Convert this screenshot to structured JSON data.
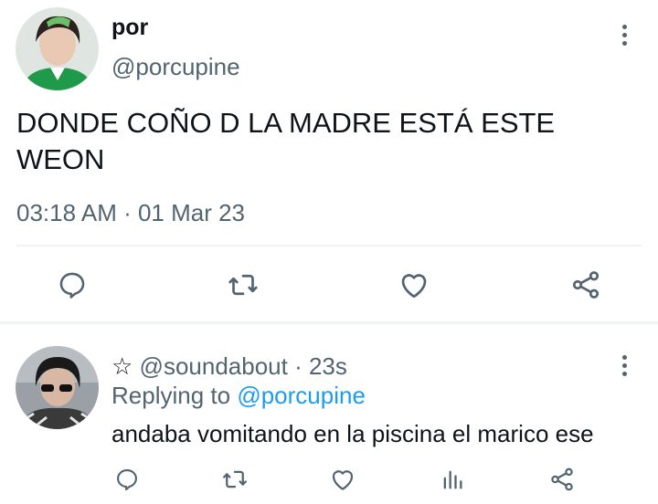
{
  "main_tweet": {
    "display_name": "por",
    "handle": "@porcupine",
    "text_line1": "DONDE COÑO D LA MADRE ESTÁ ESTE",
    "text_line2": "WEON",
    "timestamp": "03:18 AM · 01 Mar 23",
    "actions": [
      "reply-icon",
      "retweet-icon",
      "like-icon",
      "share-icon"
    ]
  },
  "reply_tweet": {
    "star": "☆",
    "handle": "@soundabout",
    "time": "· 23s",
    "replying_prefix": "Replying to",
    "replying_handle": "@porcupine",
    "text": "andaba vomitando en la piscina el marico ese",
    "actions": [
      "reply-icon",
      "retweet-icon",
      "like-icon",
      "analytics-icon",
      "share-icon"
    ]
  },
  "colors": {
    "text": "#0f1419",
    "muted": "#536471",
    "link": "#1d9bf0",
    "divider": "#eff3f4"
  }
}
